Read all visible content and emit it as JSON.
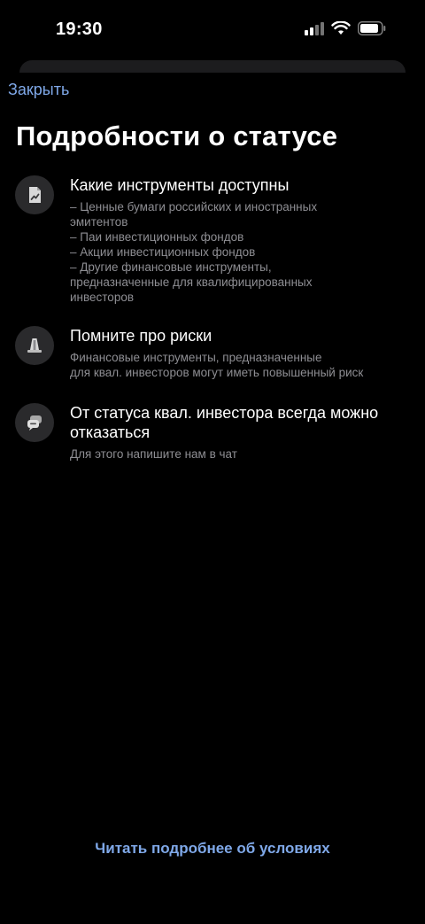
{
  "status_bar": {
    "time": "19:30",
    "icons": [
      "cellular-signal-icon",
      "wifi-icon",
      "battery-icon"
    ]
  },
  "header": {
    "close_label": "Закрыть",
    "title": "Подробности  о статусе"
  },
  "sections": [
    {
      "icon": "document-chart-icon",
      "heading": "Какие инструменты доступны",
      "lines": [
        "– Ценные бумаги российских и иностранных",
        "эмитентов",
        "– Паи инвестиционных фондов",
        "– Акции инвестиционных фондов",
        "– Другие финансовые инструменты,",
        "предназначенные для квалифицированных",
        "инвесторов"
      ]
    },
    {
      "icon": "traffic-cone-icon",
      "heading": "Помните про риски",
      "lines": [
        "Финансовые инструменты, предназначенные",
        "для квал. инвесторов могут иметь повышенный риск"
      ]
    },
    {
      "icon": "chat-bubbles-icon",
      "heading": "От статуса квал. инвестора всегда можно отказаться",
      "lines": [
        "Для этого напишите нам в чат"
      ]
    }
  ],
  "footer": {
    "link_label": "Читать подробнее об условиях"
  },
  "colors": {
    "background": "#000000",
    "accent": "#7fa8e8",
    "secondary_text": "#8e8e93",
    "icon_circle": "#2a2a2c"
  }
}
